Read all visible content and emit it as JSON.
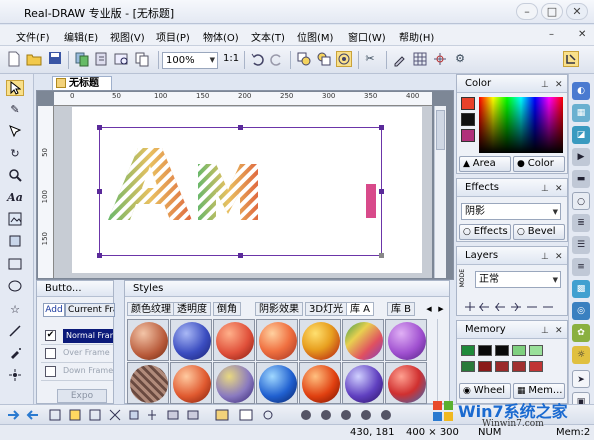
{
  "window": {
    "title": "Real-DRAW 专业版 - [无标题]",
    "minimize": "–",
    "maximize": "□",
    "close": "✕"
  },
  "menu": {
    "items": [
      "文件(F)",
      "编辑(E)",
      "视图(V)",
      "项目(P)",
      "物体(O)",
      "文本(T)",
      "位图(M)",
      "窗口(W)",
      "帮助(H)"
    ],
    "mdi_min": "–",
    "mdi_close": "✕"
  },
  "toolbar": {
    "zoom": "100%",
    "ratio": "1:1"
  },
  "document": {
    "tab": "无标题",
    "hruler": [
      "0",
      "50",
      "100",
      "150",
      "200",
      "250",
      "300",
      "350",
      "400"
    ],
    "vruler": [
      "50",
      "100",
      "150"
    ]
  },
  "buttons_panel": {
    "title": "Butto...",
    "tab_add": "Add",
    "tab_current": "Current Fra",
    "rows": [
      "Normal Frame",
      "Over Frame",
      "Down Frame"
    ],
    "footer": "Expo"
  },
  "styles_panel": {
    "title": "Styles",
    "tabs": [
      "颜色纹理",
      "透明度",
      "倒角",
      "阴影效果",
      "3D灯光",
      "库 A",
      "库 B"
    ]
  },
  "color_panel": {
    "title": "Color",
    "tab_area": "Area",
    "tab_color": "Color",
    "fill_color": "#e8412a",
    "stroke_color": "#111111",
    "accent_color": "#b0307a"
  },
  "effects_panel": {
    "title": "Effects",
    "dropdown": "阴影",
    "tab_effects": "Effects",
    "tab_bevel": "Bevel"
  },
  "layers_panel": {
    "title": "Layers",
    "mode_label": "MODE",
    "mode": "正常"
  },
  "memory_panel": {
    "title": "Memory",
    "swatches": [
      "#1f8a3a",
      "#0a0a0a",
      "#0a0a0a",
      "#7fd07f",
      "#9ae09a",
      "#2a7a3a",
      "#8a1a1a",
      "#9a2a2a",
      "#a03030",
      "#c03434"
    ],
    "tab_wheel": "Wheel",
    "tab_mem": "Mem..."
  },
  "status": {
    "coords": "430, 181",
    "size": "400 × 300",
    "num": "NUM",
    "mem": "Mem:2"
  },
  "watermark": {
    "text": "Win7系统之家",
    "url": "Winwin7.com"
  }
}
